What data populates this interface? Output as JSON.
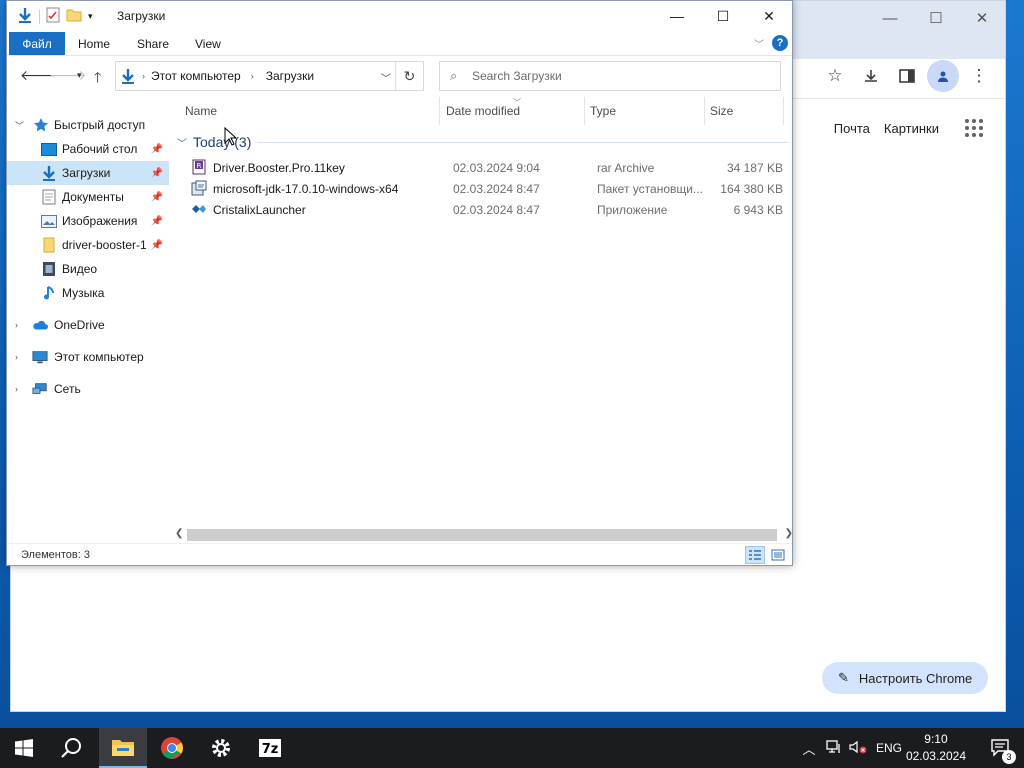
{
  "explorer": {
    "window_title": "Загрузки",
    "ribbon_tabs": [
      "Файл",
      "Home",
      "Share",
      "View"
    ],
    "address": {
      "root": "Этот компьютер",
      "current": "Загрузки"
    },
    "search_placeholder": "Search Загрузки",
    "columns": {
      "name": "Name",
      "date": "Date modified",
      "type": "Type",
      "size": "Size"
    },
    "group_label": "Today (3)",
    "files": [
      {
        "name": "Driver.Booster.Pro.11key",
        "date": "02.03.2024 9:04",
        "type": "rar Archive",
        "size": "34 187 KB",
        "icon": "rar-archive-icon"
      },
      {
        "name": "microsoft-jdk-17.0.10-windows-x64",
        "date": "02.03.2024 8:47",
        "type": "Пакет установщи...",
        "size": "164 380 KB",
        "icon": "msi-installer-icon"
      },
      {
        "name": "CristalixLauncher",
        "date": "02.03.2024 8:47",
        "type": "Приложение",
        "size": "6 943 KB",
        "icon": "app-launcher-icon"
      }
    ],
    "nav": {
      "quick_access": "Быстрый доступ",
      "pinned": [
        {
          "label": "Рабочий стол",
          "icon": "desktop-icon"
        },
        {
          "label": "Загрузки",
          "icon": "downloads-icon"
        },
        {
          "label": "Документы",
          "icon": "documents-icon"
        },
        {
          "label": "Изображения",
          "icon": "pictures-icon"
        },
        {
          "label": "driver-booster-1",
          "icon": "folder-icon"
        }
      ],
      "unpinned": [
        {
          "label": "Видео",
          "icon": "video-icon"
        },
        {
          "label": "Музыка",
          "icon": "music-icon"
        }
      ],
      "onedrive": "OneDrive",
      "this_pc": "Этот компьютер",
      "network": "Сеть"
    },
    "status_text": "Элементов: 3"
  },
  "chrome": {
    "links": {
      "mail": "Почта",
      "images": "Картинки"
    },
    "customize_label": "Настроить Chrome"
  },
  "taskbar": {
    "apps": [
      "start-icon",
      "search-icon",
      "file-explorer-icon",
      "chrome-icon",
      "settings-icon",
      "7zip-icon"
    ],
    "language": "ENG",
    "time": "9:10",
    "date": "02.03.2024",
    "notification_count": "3"
  },
  "colors": {
    "accent": "#1a6fc4",
    "selection": "#cce4f7",
    "taskbar": "#1b1c20",
    "desktop": "#1c78cf"
  }
}
